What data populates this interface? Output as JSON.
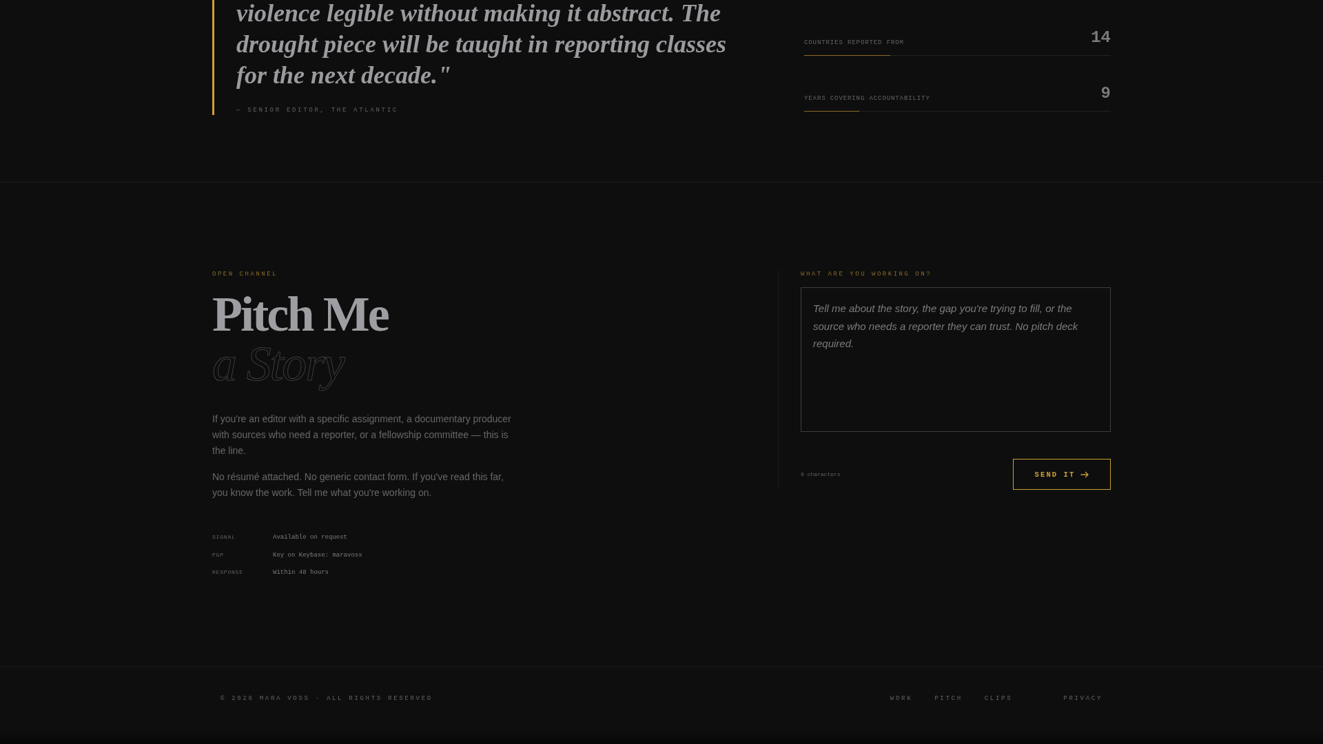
{
  "testimonial": {
    "quote": "violence legible without making it abstract. The drought piece will be taught in reporting classes for the next decade.\"",
    "attribution": "— SENIOR EDITOR, THE ATLANTIC"
  },
  "stats": [
    {
      "value": "14",
      "label": "COUNTRIES REPORTED FROM",
      "level": 0.28
    },
    {
      "value": "9",
      "label": "YEARS COVERING ACCOUNTABILITY",
      "level": 0.18
    }
  ],
  "pitch": {
    "eyebrow": "OPEN CHANNEL",
    "title": "Pitch Me",
    "title_outline": "a Story",
    "paragraphs": [
      "If you're an editor with a specific assignment, a documentary producer with sources who need a reporter, or a fellowship committee — this is the line.",
      "No résumé attached. No generic contact form. If you've read this far, you know the work. Tell me what you're working on."
    ],
    "contacts": [
      {
        "label": "SIGNAL",
        "value": "Available on request"
      },
      {
        "label": "PGP",
        "value": "Key on Keybase: maravoss"
      },
      {
        "label": "RESPONSE",
        "value": "Within 48 hours"
      }
    ]
  },
  "form": {
    "label": "WHAT ARE YOU WORKING ON?",
    "placeholder": "Tell me about the story, the gap you're trying to fill, or the source who needs a reporter they can trust. No pitch deck required.",
    "char_count": "0 characters",
    "submit": "SEND IT"
  },
  "footer": {
    "copyright": "© 2026 MARA VOSS · ALL RIGHTS RESERVED",
    "nav_links": [
      "WORK",
      "PITCH",
      "CLIPS"
    ],
    "legal_links": [
      "PRIVACY"
    ]
  }
}
